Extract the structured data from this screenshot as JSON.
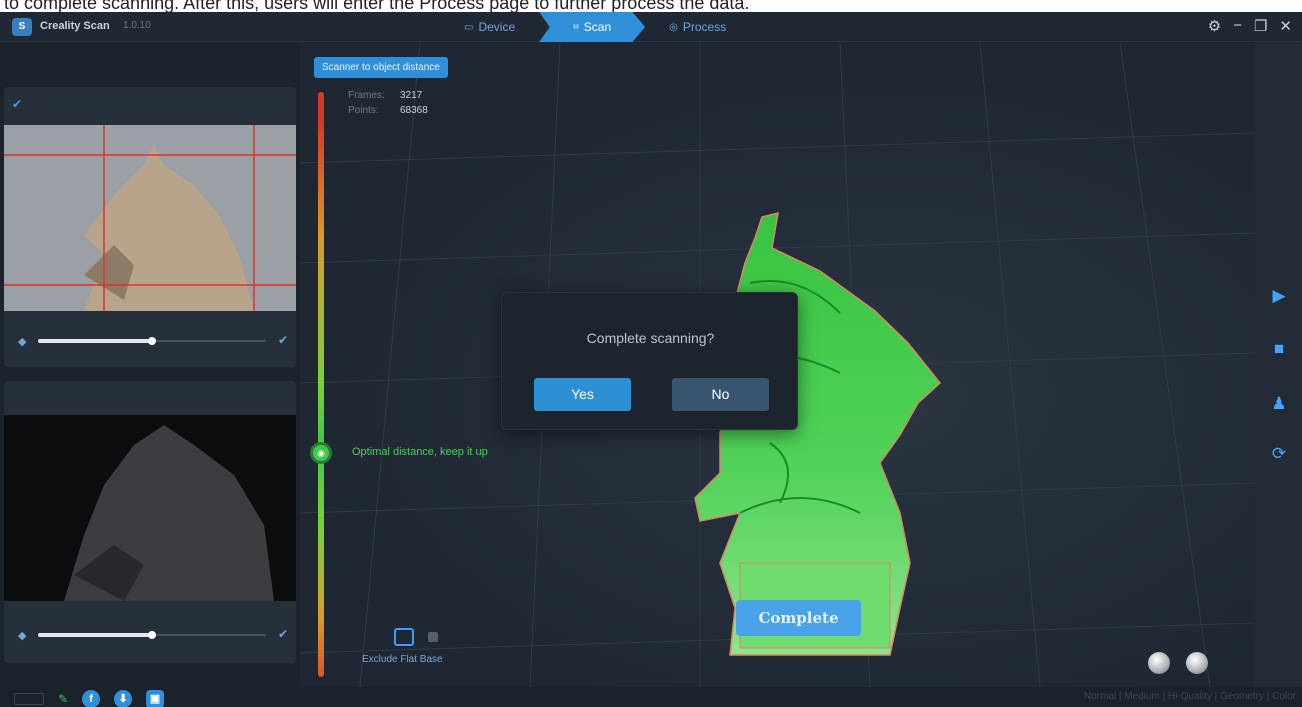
{
  "caption": "to complete scanning. After this, users will enter the Process page to further process the data.",
  "titlebar": {
    "logo": "S",
    "app_name": "Creality Scan",
    "version": "1.0.10",
    "steps": [
      {
        "label": "Device",
        "icon": "device-icon"
      },
      {
        "label": "Scan",
        "icon": "scan-icon",
        "active": true
      },
      {
        "label": "Process",
        "icon": "process-icon"
      }
    ],
    "window_controls": [
      "settings",
      "minimize",
      "restore",
      "close"
    ]
  },
  "left_panel": {
    "rgb_camera": {
      "header_icon": "check-icon",
      "slider_value": 0.5
    },
    "depth_camera": {
      "slider_value": 0.5
    }
  },
  "distance": {
    "label": "Scanner to object distance",
    "status": "Optimal distance, keep it up",
    "indicator_position": 0.62
  },
  "stats": {
    "frames_label": "Frames:",
    "frames_value": "3217",
    "points_label": "Points:",
    "points_value": "68368"
  },
  "exclude_flat_base": {
    "label": "Exclude Flat Base",
    "checked": false
  },
  "complete_button": "Complete",
  "right_tools": [
    "play-icon",
    "stop-icon",
    "stamp-icon",
    "refresh-icon"
  ],
  "bottom_bar": {
    "quality_text": "Normal | Medium | Hi-Quality | Geometry | Color"
  },
  "dialog": {
    "message": "Complete scanning?",
    "yes": "Yes",
    "no": "No"
  },
  "colors": {
    "accent": "#2f8fd8",
    "good": "#44c94e",
    "scan_mesh": "#3fc94a",
    "background": "#1d2631"
  }
}
